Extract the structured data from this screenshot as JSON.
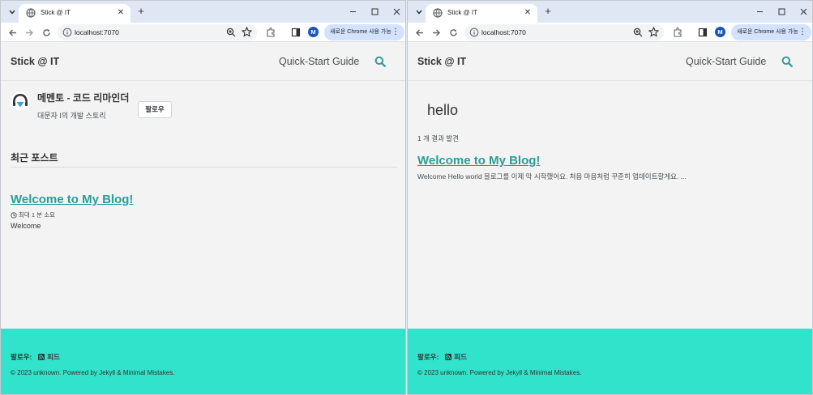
{
  "browser": {
    "tab_title": "Stick @ IT",
    "url": "localhost:7070",
    "update_chip": "새로운 Chrome 사용 가능",
    "profile_initial": "M"
  },
  "site": {
    "title": "Stick @ IT",
    "nav_quickstart": "Quick-Start Guide",
    "footer_follow": "팔로우:",
    "footer_feed": "피드",
    "copyright": "© 2023 unknown. Powered by Jekyll & Minimal Mistakes."
  },
  "home": {
    "author_name": "메멘토 - 코드 리마인더",
    "author_bio": "대문자 I의 개발 스토리",
    "follow_button": "팔로우",
    "recent_posts_title": "최근 포스트",
    "post": {
      "title": "Welcome to My Blog!",
      "read_time": "최대 1 분 소요",
      "excerpt": "Welcome"
    }
  },
  "search": {
    "query": "hello",
    "results_count": "1 개 결과 발견",
    "result": {
      "title": "Welcome to My Blog!",
      "excerpt": "Welcome Hello world 블로그를 이제 막 시작했어요. 처음 마음처럼 꾸준히 업데이트할게요. ..."
    }
  },
  "colors": {
    "accent": "#2a9d96",
    "footer_bg": "#30e3ca",
    "tabstrip_bg": "#dfe7f4",
    "update_chip_bg": "#d3e3fd"
  },
  "icons": [
    "tab-search-icon",
    "favicon-icon",
    "tab-close-icon",
    "new-tab-icon",
    "minimize-icon",
    "maximize-icon",
    "close-window-icon",
    "back-icon",
    "forward-icon",
    "reload-icon",
    "site-info-icon",
    "zoom-icon",
    "bookmark-star-icon",
    "extensions-icon",
    "side-panel-icon",
    "menu-dots-icon",
    "search-icon",
    "author-avatar-icon",
    "clock-icon",
    "rss-icon"
  ]
}
